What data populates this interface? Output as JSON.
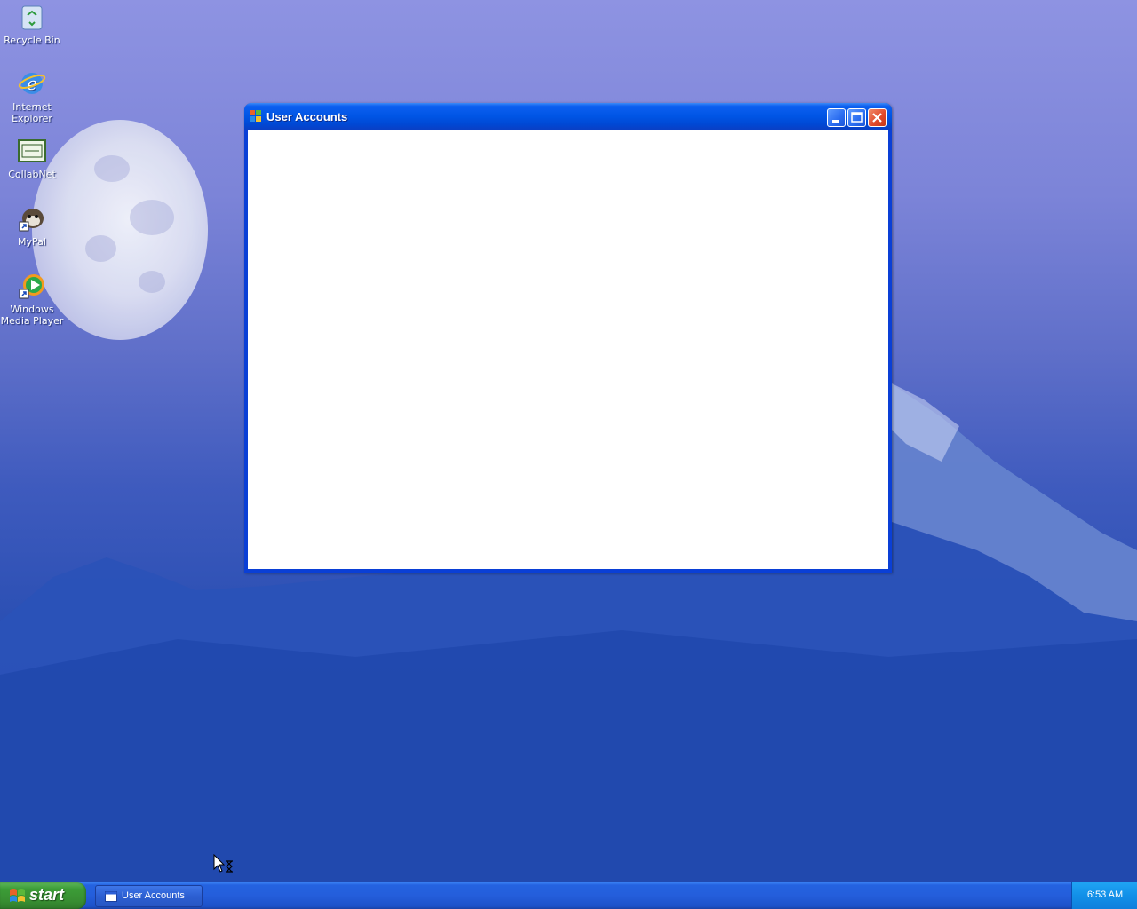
{
  "desktop": {
    "icons": [
      {
        "label": "Recycle Bin",
        "icon": "recycle-bin-icon"
      },
      {
        "label": "Internet Explorer",
        "icon": "internet-explorer-icon"
      },
      {
        "label": "CollabNet",
        "icon": "collabnet-icon"
      },
      {
        "label": "MyPal",
        "icon": "mypal-icon"
      },
      {
        "label": "Windows Media Player",
        "icon": "windows-media-player-icon"
      }
    ]
  },
  "window": {
    "title": "User Accounts",
    "icon": "user-accounts-icon",
    "controls": [
      "minimize",
      "maximize",
      "close"
    ]
  },
  "taskbar": {
    "start_label": "start",
    "tasks": [
      {
        "label": "User Accounts",
        "icon": "window-icon"
      }
    ],
    "clock": "6:53 AM"
  },
  "colors": {
    "titlebar": "#0055e5",
    "taskbar": "#245edb",
    "start": "#388e32",
    "tray": "#1290e8",
    "close_button": "#e0482a"
  }
}
